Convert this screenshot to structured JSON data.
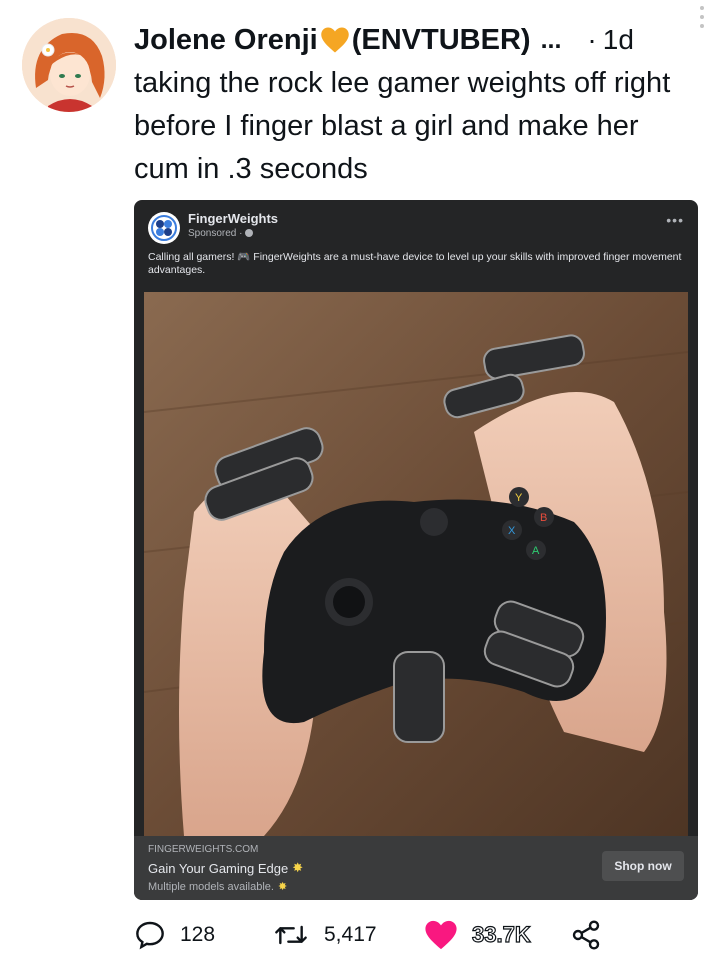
{
  "user": {
    "display_name": "Jolene Orenji",
    "tag": "(ENVTUBER)",
    "truncation": "...",
    "separator": "·",
    "timestamp": "1d",
    "heart_color": "#f5a623"
  },
  "tweet": {
    "text": "taking the rock lee gamer weights off right before I finger blast a girl and make her cum in .3 seconds"
  },
  "ad": {
    "page_name": "FingerWeights",
    "sponsored_label": "Sponsored · ",
    "body": "Calling all gamers! 🎮 FingerWeights are a must-have device to level up your skills with improved finger movement advantages.",
    "domain": "FINGERWEIGHTS.COM",
    "headline": "Gain Your Gaming Edge",
    "subtext": "Multiple models available.",
    "cta": "Shop now",
    "image_alt_icon": "game-controller-with-finger-weights"
  },
  "actions": {
    "replies": "128",
    "retweets": "5,417",
    "likes": "33.7K",
    "like_color": "#f91880"
  }
}
